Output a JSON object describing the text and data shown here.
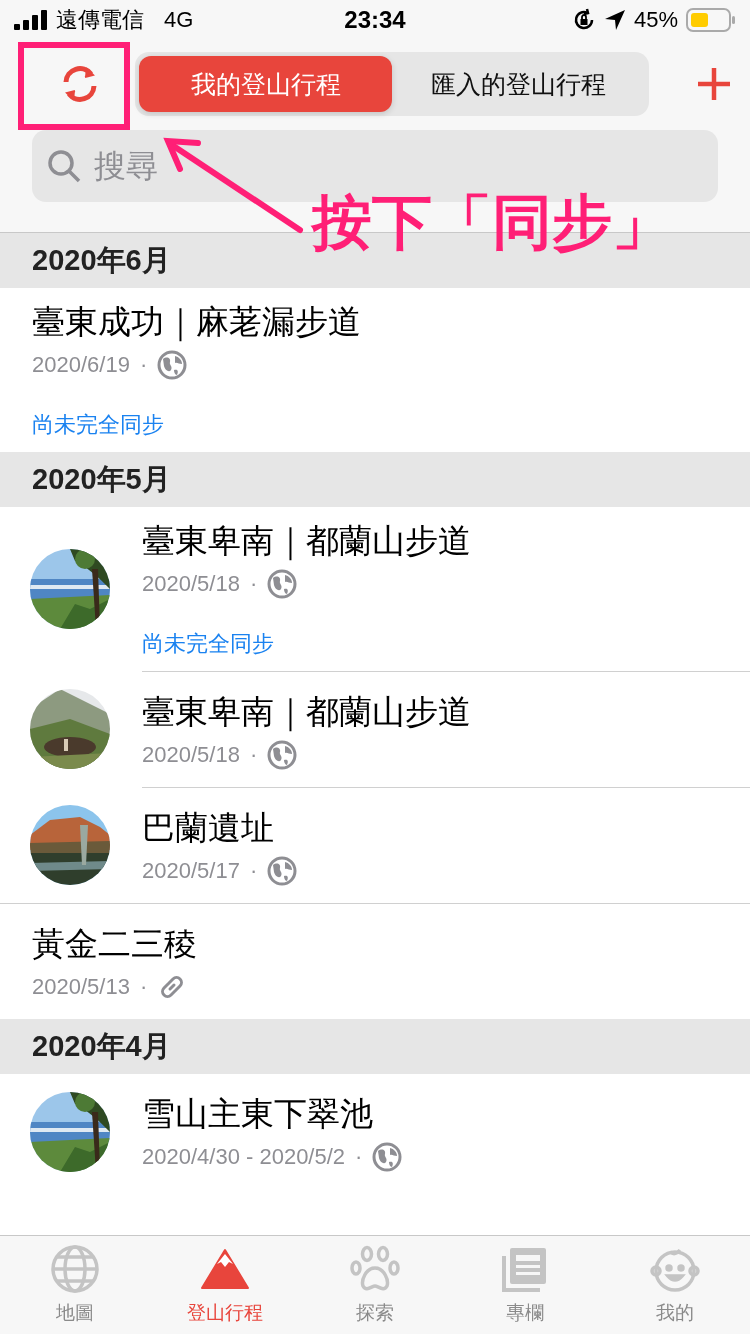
{
  "status_bar": {
    "carrier": "遠傳電信",
    "network": "4G",
    "time": "23:34",
    "battery": "45%"
  },
  "segments": [
    {
      "label": "我的登山行程",
      "selected": true
    },
    {
      "label": "匯入的登山行程",
      "selected": false
    }
  ],
  "search": {
    "placeholder": "搜尋"
  },
  "sections": [
    {
      "title": "2020年6月",
      "trips": [
        {
          "title": "臺東成功｜麻荖漏步道",
          "date": "2020/6/19",
          "separator": "·",
          "link_shared": false,
          "thumbnail": false,
          "sync_note": "尚未完全同步"
        }
      ]
    },
    {
      "title": "2020年5月",
      "trips": [
        {
          "title": "臺東卑南｜都蘭山步道",
          "date": "2020/5/18",
          "separator": "·",
          "link_shared": false,
          "thumbnail": true,
          "sync_note": "尚未完全同步"
        },
        {
          "title": "臺東卑南｜都蘭山步道",
          "date": "2020/5/18",
          "separator": "·",
          "link_shared": false,
          "thumbnail": true
        },
        {
          "title": "巴蘭遺址",
          "date": "2020/5/17",
          "separator": "·",
          "link_shared": false,
          "thumbnail": true
        },
        {
          "title": "黃金二三稜",
          "date": "2020/5/13",
          "separator": "·",
          "link_shared": true,
          "thumbnail": false
        }
      ]
    },
    {
      "title": "2020年4月",
      "trips": [
        {
          "title": "雪山主東下翠池",
          "date": "2020/4/30 - 2020/5/2",
          "separator": "·",
          "link_shared": false,
          "thumbnail": true
        }
      ]
    }
  ],
  "tab_bar": [
    {
      "label": "地圖",
      "selected": false
    },
    {
      "label": "登山行程",
      "selected": true
    },
    {
      "label": "探索",
      "selected": false
    },
    {
      "label": "專欄",
      "selected": false
    },
    {
      "label": "我的",
      "selected": false
    }
  ],
  "annotation": {
    "text": "按下「同步」"
  }
}
